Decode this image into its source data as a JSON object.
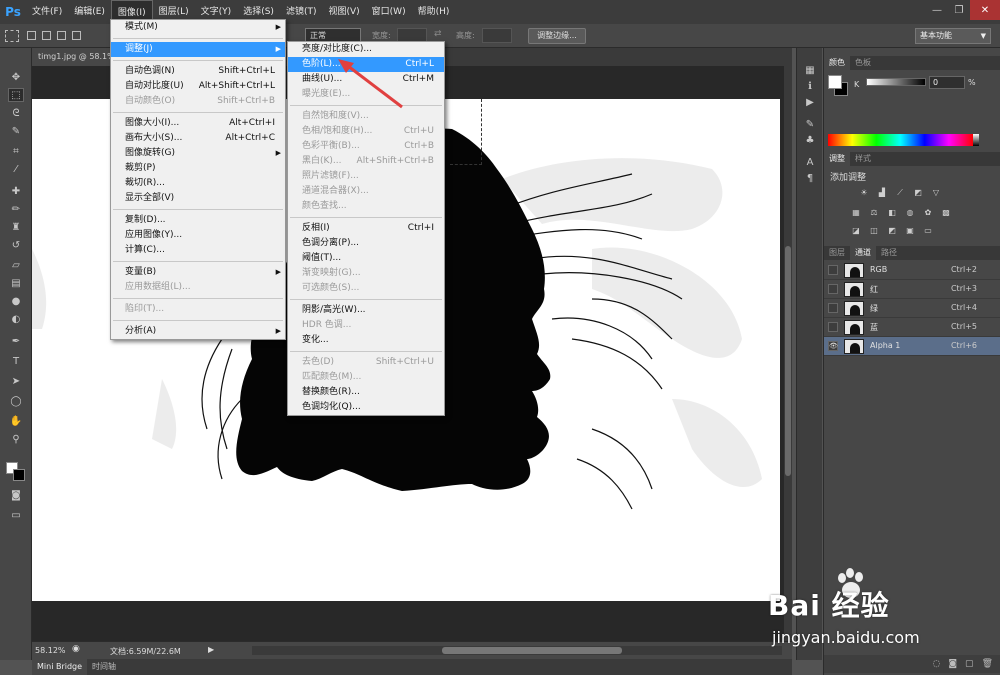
{
  "app": {
    "logo": "Ps"
  },
  "menubar": {
    "items": [
      "文件(F)",
      "编辑(E)",
      "图像(I)",
      "图层(L)",
      "文字(Y)",
      "选择(S)",
      "滤镜(T)",
      "视图(V)",
      "窗口(W)",
      "帮助(H)"
    ],
    "active": "图像(I)"
  },
  "window_controls": [
    "—",
    "❐",
    "✕"
  ],
  "options": {
    "style_label": "正常",
    "width_label": "宽度:",
    "height_label": "高度:",
    "refine_button": "调整边缘...",
    "workspace": "基本功能"
  },
  "document": {
    "tab_label": "timg1.jpg @ 58.1%"
  },
  "status": {
    "zoom": "58.12%",
    "doc_info": "文档:6.59M/22.6M"
  },
  "bottom_tabs": [
    "Mini Bridge",
    "时间轴"
  ],
  "color_panel": {
    "tabs": [
      "颜色",
      "色板"
    ],
    "channel_label": "K",
    "value": "0",
    "unit": "%"
  },
  "adjust_panel": {
    "tabs": [
      "调整",
      "样式"
    ],
    "title": "添加调整"
  },
  "channels_panel": {
    "tabs": [
      "图层",
      "通道",
      "路径"
    ],
    "rows": [
      {
        "name": "RGB",
        "shortcut": "Ctrl+2",
        "visible": false,
        "active": false
      },
      {
        "name": "红",
        "shortcut": "Ctrl+3",
        "visible": false,
        "active": false
      },
      {
        "name": "绿",
        "shortcut": "Ctrl+4",
        "visible": false,
        "active": false
      },
      {
        "name": "蓝",
        "shortcut": "Ctrl+5",
        "visible": false,
        "active": false
      },
      {
        "name": "Alpha 1",
        "shortcut": "Ctrl+6",
        "visible": true,
        "active": true
      }
    ]
  },
  "image_menu": {
    "items": [
      {
        "label": "模式(M)",
        "shortcut": "",
        "submenu": true
      },
      {
        "sep": true
      },
      {
        "label": "调整(J)",
        "shortcut": "",
        "submenu": true,
        "highlight": true
      },
      {
        "sep": true
      },
      {
        "label": "自动色调(N)",
        "shortcut": "Shift+Ctrl+L"
      },
      {
        "label": "自动对比度(U)",
        "shortcut": "Alt+Shift+Ctrl+L"
      },
      {
        "label": "自动颜色(O)",
        "shortcut": "Shift+Ctrl+B",
        "disabled": true
      },
      {
        "sep": true
      },
      {
        "label": "图像大小(I)...",
        "shortcut": "Alt+Ctrl+I"
      },
      {
        "label": "画布大小(S)...",
        "shortcut": "Alt+Ctrl+C"
      },
      {
        "label": "图像旋转(G)",
        "shortcut": "",
        "submenu": true
      },
      {
        "label": "裁剪(P)",
        "shortcut": ""
      },
      {
        "label": "裁切(R)...",
        "shortcut": ""
      },
      {
        "label": "显示全部(V)",
        "shortcut": ""
      },
      {
        "sep": true
      },
      {
        "label": "复制(D)...",
        "shortcut": ""
      },
      {
        "label": "应用图像(Y)...",
        "shortcut": ""
      },
      {
        "label": "计算(C)...",
        "shortcut": ""
      },
      {
        "sep": true
      },
      {
        "label": "变量(B)",
        "shortcut": "",
        "submenu": true
      },
      {
        "label": "应用数据组(L)...",
        "shortcut": "",
        "disabled": true
      },
      {
        "sep": true
      },
      {
        "label": "陷印(T)...",
        "shortcut": "",
        "disabled": true
      },
      {
        "sep": true
      },
      {
        "label": "分析(A)",
        "shortcut": "",
        "submenu": true
      }
    ]
  },
  "adjust_menu": {
    "items": [
      {
        "label": "亮度/对比度(C)...",
        "shortcut": ""
      },
      {
        "label": "色阶(L)...",
        "shortcut": "Ctrl+L",
        "highlight": true
      },
      {
        "label": "曲线(U)...",
        "shortcut": "Ctrl+M"
      },
      {
        "label": "曝光度(E)...",
        "shortcut": "",
        "disabled": true
      },
      {
        "sep": true
      },
      {
        "label": "自然饱和度(V)...",
        "shortcut": "",
        "disabled": true
      },
      {
        "label": "色相/饱和度(H)...",
        "shortcut": "Ctrl+U",
        "disabled": true
      },
      {
        "label": "色彩平衡(B)...",
        "shortcut": "Ctrl+B",
        "disabled": true
      },
      {
        "label": "黑白(K)...",
        "shortcut": "Alt+Shift+Ctrl+B",
        "disabled": true
      },
      {
        "label": "照片滤镜(F)...",
        "shortcut": "",
        "disabled": true
      },
      {
        "label": "通道混合器(X)...",
        "shortcut": "",
        "disabled": true
      },
      {
        "label": "颜色查找...",
        "shortcut": "",
        "disabled": true
      },
      {
        "sep": true
      },
      {
        "label": "反相(I)",
        "shortcut": "Ctrl+I"
      },
      {
        "label": "色调分离(P)...",
        "shortcut": ""
      },
      {
        "label": "阈值(T)...",
        "shortcut": ""
      },
      {
        "label": "渐变映射(G)...",
        "shortcut": "",
        "disabled": true
      },
      {
        "label": "可选颜色(S)...",
        "shortcut": "",
        "disabled": true
      },
      {
        "sep": true
      },
      {
        "label": "阴影/高光(W)...",
        "shortcut": ""
      },
      {
        "label": "HDR 色调...",
        "shortcut": "",
        "disabled": true
      },
      {
        "label": "变化...",
        "shortcut": ""
      },
      {
        "sep": true
      },
      {
        "label": "去色(D)",
        "shortcut": "Shift+Ctrl+U",
        "disabled": true
      },
      {
        "label": "匹配颜色(M)...",
        "shortcut": "",
        "disabled": true
      },
      {
        "label": "替换颜色(R)...",
        "shortcut": ""
      },
      {
        "label": "色调均化(Q)...",
        "shortcut": ""
      }
    ]
  },
  "watermark": {
    "brand": "Bai 经验",
    "url": "jingyan.baidu.com"
  },
  "colors": {
    "highlight": "#3399ff",
    "accent": "#e04040"
  }
}
